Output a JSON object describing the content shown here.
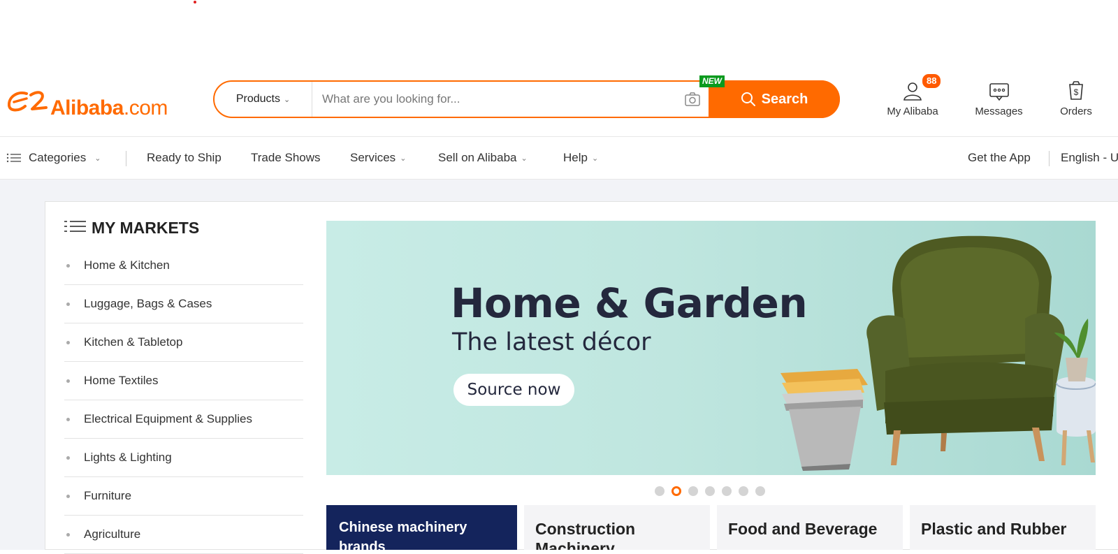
{
  "header": {
    "logo_text": "Alibaba",
    "logo_suffix": ".com",
    "search": {
      "category": "Products",
      "placeholder": "What are you looking for...",
      "new_badge": "NEW",
      "button_label": "Search"
    },
    "actions": [
      {
        "label": "My Alibaba",
        "icon": "user-icon",
        "badge": "88"
      },
      {
        "label": "Messages",
        "icon": "message-icon"
      },
      {
        "label": "Orders",
        "icon": "orders-icon"
      }
    ]
  },
  "nav": {
    "categories": "Categories",
    "items": [
      "Ready to Ship",
      "Trade Shows",
      "Services",
      "Sell on Alibaba",
      "Help"
    ],
    "get_app": "Get the App",
    "language": "English - U"
  },
  "markets": {
    "title": "MY MARKETS",
    "items": [
      "Home & Kitchen",
      "Luggage, Bags & Cases",
      "Kitchen & Tabletop",
      "Home Textiles",
      "Electrical Equipment & Supplies",
      "Lights & Lighting",
      "Furniture",
      "Agriculture"
    ]
  },
  "banner": {
    "title": "Home & Garden",
    "subtitle": "The latest décor",
    "button": "Source now",
    "slide_count": 7,
    "active_slide": 2
  },
  "cards": [
    {
      "label": "Chinese machinery brands"
    },
    {
      "label": "Construction Machinery"
    },
    {
      "label": "Food and Beverage"
    },
    {
      "label": "Plastic and Rubber"
    }
  ],
  "colors": {
    "brand": "#ff6a00",
    "new_badge": "#0a9a1e",
    "card_dark": "#14245c",
    "banner_bg": "#c2e8e1"
  }
}
